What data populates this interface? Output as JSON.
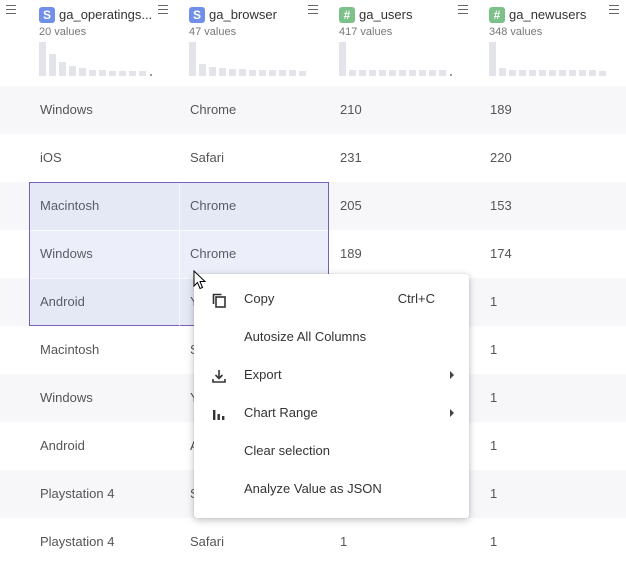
{
  "columns": [
    {
      "name": "ga_operatingsystem",
      "title": "ga_operatings...",
      "type": "S",
      "count": "20 values"
    },
    {
      "name": "ga_browser",
      "title": "ga_browser",
      "type": "S",
      "count": "47 values"
    },
    {
      "name": "ga_users",
      "title": "ga_users",
      "type": "#",
      "count": "417 values"
    },
    {
      "name": "ga_newusers",
      "title": "ga_newusers",
      "type": "#",
      "count": "348 values"
    }
  ],
  "rows": [
    [
      "Windows",
      "Chrome",
      "210",
      "189"
    ],
    [
      "iOS",
      "Safari",
      "231",
      "220"
    ],
    [
      "Macintosh",
      "Chrome",
      "205",
      "153"
    ],
    [
      "Windows",
      "Chrome",
      "189",
      "174"
    ],
    [
      "Android",
      "Y",
      "",
      "1"
    ],
    [
      "Macintosh",
      "S",
      "",
      "1"
    ],
    [
      "Windows",
      "Y",
      "",
      "1"
    ],
    [
      "Android",
      "A",
      "",
      "1"
    ],
    [
      "Playstation 4",
      "S",
      "",
      "1"
    ],
    [
      "Playstation 4",
      "Safari",
      "1",
      "1"
    ]
  ],
  "context_menu": {
    "copy_label": "Copy",
    "copy_shortcut": "Ctrl+C",
    "autosize_label": "Autosize All Columns",
    "export_label": "Export",
    "chart_range_label": "Chart Range",
    "clear_selection_label": "Clear selection",
    "analyze_json_label": "Analyze Value as JSON"
  },
  "colors": {
    "string_badge": "#6f8fe8",
    "number_badge": "#7cc08a",
    "selection_border": "#7a5fb8"
  }
}
